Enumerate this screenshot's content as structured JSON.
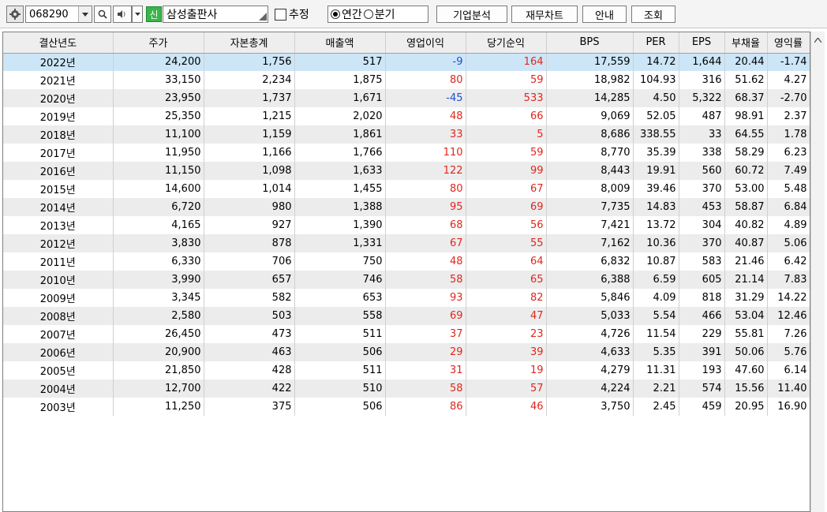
{
  "toolbar": {
    "icons": {
      "gear": "gear-icon",
      "search": "search-icon",
      "speaker": "speaker-icon",
      "dropdown": "chevron-down-icon"
    },
    "stock_code": "068290",
    "new_badge": "신",
    "company_name": "삼성출판사",
    "estimate_label": "추정",
    "radio_annual": "연간",
    "radio_quarter": "분기",
    "btn_analysis": "기업분석",
    "btn_finchart": "재무차트",
    "btn_info": "안내",
    "btn_query": "조회"
  },
  "table": {
    "headers": [
      "결산년도",
      "주가",
      "자본총계",
      "매출액",
      "영업이익",
      "당기순익",
      "BPS",
      "PER",
      "EPS",
      "부채율",
      "영익률"
    ],
    "rows": [
      [
        "2022년",
        "24,200",
        "1,756",
        "517",
        "-9",
        "164",
        "17,559",
        "14.72",
        "1,644",
        "20.44",
        "-1.74"
      ],
      [
        "2021년",
        "33,150",
        "2,234",
        "1,875",
        "80",
        "59",
        "18,982",
        "104.93",
        "316",
        "51.62",
        "4.27"
      ],
      [
        "2020년",
        "23,950",
        "1,737",
        "1,671",
        "-45",
        "533",
        "14,285",
        "4.50",
        "5,322",
        "68.37",
        "-2.70"
      ],
      [
        "2019년",
        "25,350",
        "1,215",
        "2,020",
        "48",
        "66",
        "9,069",
        "52.05",
        "487",
        "98.91",
        "2.37"
      ],
      [
        "2018년",
        "11,100",
        "1,159",
        "1,861",
        "33",
        "5",
        "8,686",
        "338.55",
        "33",
        "64.55",
        "1.78"
      ],
      [
        "2017년",
        "11,950",
        "1,166",
        "1,766",
        "110",
        "59",
        "8,770",
        "35.39",
        "338",
        "58.29",
        "6.23"
      ],
      [
        "2016년",
        "11,150",
        "1,098",
        "1,633",
        "122",
        "99",
        "8,443",
        "19.91",
        "560",
        "60.72",
        "7.49"
      ],
      [
        "2015년",
        "14,600",
        "1,014",
        "1,455",
        "80",
        "67",
        "8,009",
        "39.46",
        "370",
        "53.00",
        "5.48"
      ],
      [
        "2014년",
        "6,720",
        "980",
        "1,388",
        "95",
        "69",
        "7,735",
        "14.83",
        "453",
        "58.87",
        "6.84"
      ],
      [
        "2013년",
        "4,165",
        "927",
        "1,390",
        "68",
        "56",
        "7,421",
        "13.72",
        "304",
        "40.82",
        "4.89"
      ],
      [
        "2012년",
        "3,830",
        "878",
        "1,331",
        "67",
        "55",
        "7,162",
        "10.36",
        "370",
        "40.87",
        "5.06"
      ],
      [
        "2011년",
        "6,330",
        "706",
        "750",
        "48",
        "64",
        "6,832",
        "10.87",
        "583",
        "21.46",
        "6.42"
      ],
      [
        "2010년",
        "3,990",
        "657",
        "746",
        "58",
        "65",
        "6,388",
        "6.59",
        "605",
        "21.14",
        "7.83"
      ],
      [
        "2009년",
        "3,345",
        "582",
        "653",
        "93",
        "82",
        "5,846",
        "4.09",
        "818",
        "31.29",
        "14.22"
      ],
      [
        "2008년",
        "2,580",
        "503",
        "558",
        "69",
        "47",
        "5,033",
        "5.54",
        "466",
        "53.04",
        "12.46"
      ],
      [
        "2007년",
        "26,450",
        "473",
        "511",
        "37",
        "23",
        "4,726",
        "11.54",
        "229",
        "55.81",
        "7.26"
      ],
      [
        "2006년",
        "20,900",
        "463",
        "506",
        "29",
        "39",
        "4,633",
        "5.35",
        "391",
        "50.06",
        "5.76"
      ],
      [
        "2005년",
        "21,850",
        "428",
        "511",
        "31",
        "19",
        "4,279",
        "11.31",
        "193",
        "47.60",
        "6.14"
      ],
      [
        "2004년",
        "12,700",
        "422",
        "510",
        "58",
        "57",
        "4,224",
        "2.21",
        "574",
        "15.56",
        "11.40"
      ],
      [
        "2003년",
        "11,250",
        "375",
        "506",
        "86",
        "46",
        "3,750",
        "2.45",
        "459",
        "20.95",
        "16.90"
      ]
    ]
  },
  "colors": {
    "positive": "#e0261c",
    "negative": "#1a4fd6",
    "selected_row": "#cde6f7",
    "alt_row": "#ececec",
    "new_badge": "#39b54a"
  }
}
